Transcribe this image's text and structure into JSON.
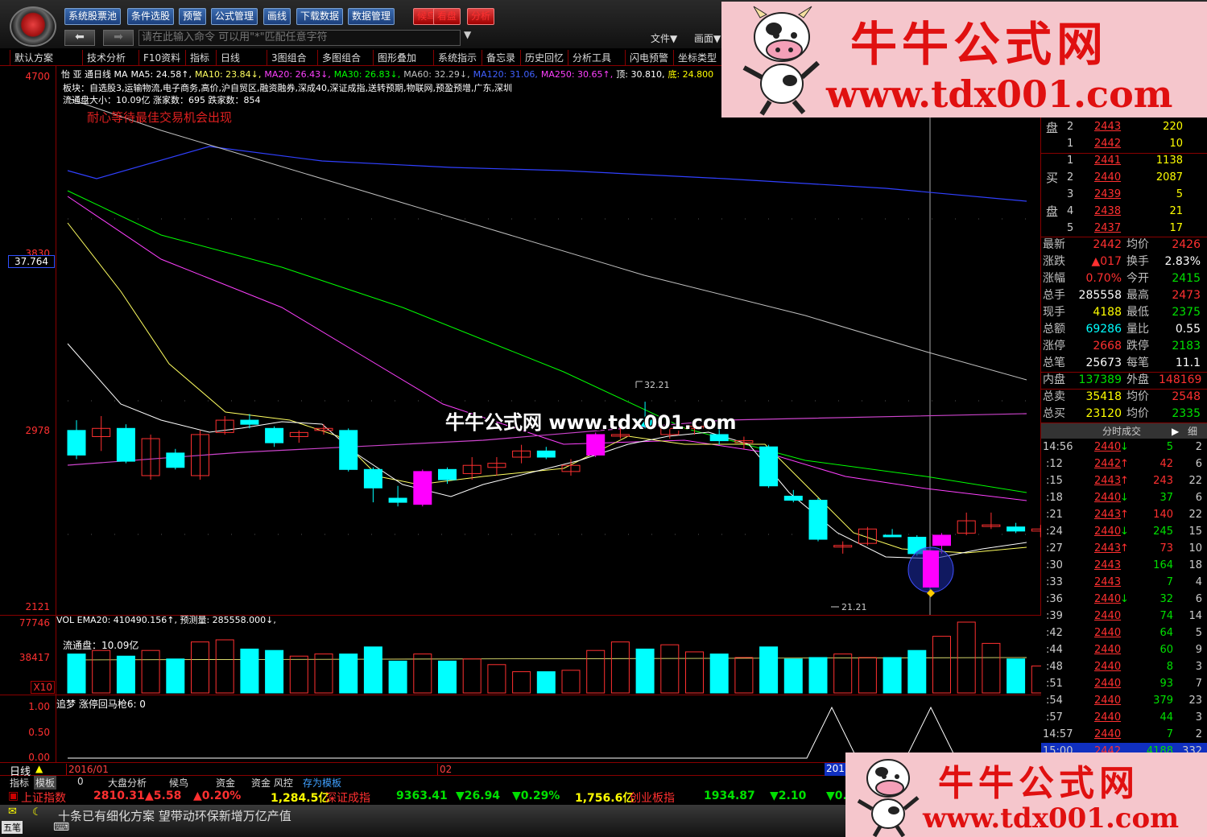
{
  "toolbar": {
    "buttons": [
      "系统股票池",
      "条件选股",
      "预警",
      "公式管理",
      "画线",
      "下载数据",
      "数据管理",
      "候鸟",
      "看盘",
      "分析"
    ],
    "command_placeholder": "请在此输入命令   可以用\"*\"匹配任意字符",
    "file_menu": "文件▼",
    "view_menu": "画面▼"
  },
  "toolbar2": [
    "默认方案",
    "技术分析",
    "F10资料",
    "指标",
    "日线",
    "3图组合",
    "多图组合",
    "图形叠加",
    "系统指示",
    "备忘录",
    "历史回忆",
    "分析工具",
    "闪电预警",
    "坐标类型"
  ],
  "chart": {
    "stock_line": "怡 亚 通日线 MA MA5: 24.58↑, MA10: 23.84↓, MA20: 26.43↓, MA30: 26.83↓, MA60: 32.29↓, MA120: 31.06, MA250: 30.65↑, 顶: 30.810, 底: 24.800",
    "ma_labels": [
      {
        "text": "怡 亚 通日线 MA",
        "color": "#ffffff"
      },
      {
        "text": "MA5: 24.58↑,",
        "color": "#ffffff"
      },
      {
        "text": "MA10: 23.84↓,",
        "color": "#ffff60"
      },
      {
        "text": "MA20: 26.43↓,",
        "color": "#ff40ff"
      },
      {
        "text": "MA30: 26.83↓,",
        "color": "#00ff00"
      },
      {
        "text": "MA60: 32.29↓,",
        "color": "#c0c0c0"
      },
      {
        "text": "MA120: 31.06,",
        "color": "#4060ff"
      },
      {
        "text": "MA250: 30.65↑,",
        "color": "#ff40ff"
      },
      {
        "text": "顶: 30.810,",
        "color": "#ffffff"
      },
      {
        "text": "底: 24.800",
        "color": "#ffff00"
      }
    ],
    "sector": "板块：自选股3,运输物流,电子商务,高价,沪自贸区,融资融券,深成40,深证成指,送转预期,物联网,预盈预增,广东,深圳",
    "circulation": "流通盘大小：10.09亿   涨家数：695    跌家数：854",
    "advice": "耐心等待最佳交易机会出现",
    "y_labels": [
      "4700",
      "3830",
      "2978",
      "2121"
    ],
    "price_box": "37.764",
    "high_label": "32.21",
    "low_label": "21.21",
    "watermark_center": "牛牛公式网 www.tdx001.com"
  },
  "volume": {
    "header": "VOL EMA20: 410490.156↑, 预测量: 285558.000↓,",
    "float": "流通盘：10.09亿",
    "y_labels": [
      "77746",
      "38417",
      "X10"
    ]
  },
  "indicator": {
    "header": "追梦 涨停回马枪6: 0",
    "y_labels": [
      "1.00",
      "0.50",
      "0.00"
    ]
  },
  "timeline": {
    "period": "日线",
    "d1": "2016/01",
    "d2": "02",
    "d3": "201"
  },
  "tabs": [
    "指标",
    "模板",
    "0",
    "大盘分析",
    "候鸟",
    "资金",
    "资金 风控",
    "存为模板"
  ],
  "index_bar": [
    {
      "name": "上证指数",
      "value": "2810.31",
      "chg": "▲5.58",
      "pct": "▲0.20%",
      "amt": "1,284.5亿"
    },
    {
      "name": "深证成指",
      "value": "9363.41",
      "chg": "▼26.94",
      "pct": "▼0.29%",
      "amt": "1,756.6亿"
    },
    {
      "name": "创业板指",
      "value": "1934.87",
      "chg": "▼2.10",
      "pct": "▼0.",
      "amt": ""
    }
  ],
  "news": "十条已有细化方案 望带动环保新增万亿产值",
  "input_mode": "五笔",
  "orderbook": {
    "sell": [
      {
        "lvl": "2",
        "price": "2443",
        "vol": "220"
      },
      {
        "lvl": "1",
        "price": "2442",
        "vol": "10"
      }
    ],
    "buy": [
      {
        "lvl": "1",
        "price": "2441",
        "vol": "1138"
      },
      {
        "lvl": "2",
        "price": "2440",
        "vol": "2087"
      },
      {
        "lvl": "3",
        "price": "2439",
        "vol": "5"
      },
      {
        "lvl": "4",
        "price": "2438",
        "vol": "21"
      },
      {
        "lvl": "5",
        "price": "2437",
        "vol": "17"
      }
    ],
    "sell_label": "盘",
    "buy_label_1": "买",
    "buy_label_2": "盘"
  },
  "stats": [
    {
      "l1": "最新",
      "v1": "2442",
      "c1": "#ff3030",
      "l2": "均价",
      "v2": "2426",
      "c2": "#ff3030"
    },
    {
      "l1": "涨跌",
      "v1": "▲017",
      "c1": "#ff3030",
      "l2": "换手",
      "v2": "2.83%",
      "c2": "#ffffff"
    },
    {
      "l1": "涨幅",
      "v1": "0.70%",
      "c1": "#ff3030",
      "l2": "今开",
      "v2": "2415",
      "c2": "#00e000"
    },
    {
      "l1": "总手",
      "v1": "285558",
      "c1": "#ffffff",
      "l2": "最高",
      "v2": "2473",
      "c2": "#ff3030"
    },
    {
      "l1": "现手",
      "v1": "4188",
      "c1": "#ffff00",
      "l2": "最低",
      "v2": "2375",
      "c2": "#00e000"
    },
    {
      "l1": "总额",
      "v1": "69286",
      "c1": "#00ffff",
      "l2": "量比",
      "v2": "0.55",
      "c2": "#ffffff"
    },
    {
      "l1": "涨停",
      "v1": "2668",
      "c1": "#ff3030",
      "l2": "跌停",
      "v2": "2183",
      "c2": "#00e000"
    },
    {
      "l1": "总笔",
      "v1": "25673",
      "c1": "#ffffff",
      "l2": "每笔",
      "v2": "11.1",
      "c2": "#ffffff"
    },
    {
      "l1": "内盘",
      "v1": "137389",
      "c1": "#00e000",
      "l2": "外盘",
      "v2": "148169",
      "c2": "#ff3030"
    },
    {
      "l1": "总卖",
      "v1": "35418",
      "c1": "#ffff00",
      "l2": "均价",
      "v2": "2548",
      "c2": "#ff3030"
    },
    {
      "l1": "总买",
      "v1": "23120",
      "c1": "#ffff00",
      "l2": "均价",
      "v2": "2335",
      "c2": "#00e000"
    }
  ],
  "trades_header": "分时成交",
  "trades_tab": "细",
  "trades": [
    {
      "t": "14:56",
      "p": "2440↓",
      "v": "5",
      "n": "2"
    },
    {
      "t": ":12",
      "p": "2442↑",
      "v": "42",
      "n": "6"
    },
    {
      "t": ":15",
      "p": "2443↑",
      "v": "243",
      "n": "22"
    },
    {
      "t": ":18",
      "p": "2440↓",
      "v": "37",
      "n": "6"
    },
    {
      "t": ":21",
      "p": "2443↑",
      "v": "140",
      "n": "22"
    },
    {
      "t": ":24",
      "p": "2440↓",
      "v": "245",
      "n": "15"
    },
    {
      "t": ":27",
      "p": "2443↑",
      "v": "73",
      "n": "10"
    },
    {
      "t": ":30",
      "p": "2443",
      "v": "164",
      "n": "18"
    },
    {
      "t": ":33",
      "p": "2443",
      "v": "7",
      "n": "4"
    },
    {
      "t": ":36",
      "p": "2440↓",
      "v": "32",
      "n": "6"
    },
    {
      "t": ":39",
      "p": "2440",
      "v": "74",
      "n": "14"
    },
    {
      "t": ":42",
      "p": "2440",
      "v": "64",
      "n": "5"
    },
    {
      "t": ":44",
      "p": "2440",
      "v": "60",
      "n": "9"
    },
    {
      "t": ":48",
      "p": "2440",
      "v": "8",
      "n": "3"
    },
    {
      "t": ":51",
      "p": "2440",
      "v": "93",
      "n": "7"
    },
    {
      "t": ":54",
      "p": "2440",
      "v": "379",
      "n": "23"
    },
    {
      "t": ":57",
      "p": "2440",
      "v": "44",
      "n": "3"
    },
    {
      "t": "14:57",
      "p": "2440",
      "v": "7",
      "n": "2"
    },
    {
      "t": "15:00",
      "p": "2442",
      "v": "4188",
      "n": "332"
    }
  ],
  "watermark": {
    "title": "牛牛公式网",
    "url": "www.tdx001.com"
  },
  "colors": {
    "up": "#ff3030",
    "down": "#00ffff",
    "magenta": "#ff00ff",
    "ma5": "#ffffff",
    "ma10": "#ffff60",
    "ma20": "#ff40ff",
    "ma30": "#00ff00",
    "ma60": "#c0c0c0",
    "ma120": "#3040ff",
    "ma250": "#cc44cc"
  },
  "chart_data": {
    "type": "candlestick",
    "y_ticks": [
      "4700",
      "3830",
      "2978",
      "2121"
    ],
    "candles": [
      {
        "o": 2860,
        "c": 2980,
        "h": 3030,
        "l": 2840,
        "dir": "down"
      },
      {
        "o": 2950,
        "c": 2990,
        "h": 3050,
        "l": 2880,
        "dir": "up"
      },
      {
        "o": 2990,
        "c": 2830,
        "h": 3010,
        "l": 2820,
        "dir": "down"
      },
      {
        "o": 2760,
        "c": 2940,
        "h": 2960,
        "l": 2740,
        "dir": "up"
      },
      {
        "o": 2870,
        "c": 2800,
        "h": 2890,
        "l": 2790,
        "dir": "down"
      },
      {
        "o": 2760,
        "c": 2960,
        "h": 2980,
        "l": 2740,
        "dir": "up"
      },
      {
        "o": 2970,
        "c": 3030,
        "h": 3050,
        "l": 2960,
        "dir": "up"
      },
      {
        "o": 3030,
        "c": 3010,
        "h": 3060,
        "l": 2990,
        "dir": "down"
      },
      {
        "o": 2990,
        "c": 2920,
        "h": 3000,
        "l": 2900,
        "dir": "down"
      },
      {
        "o": 2950,
        "c": 2970,
        "h": 2980,
        "l": 2920,
        "dir": "up"
      },
      {
        "o": 2980,
        "c": 2990,
        "h": 3010,
        "l": 2960,
        "dir": "up"
      },
      {
        "o": 2980,
        "c": 2790,
        "h": 2990,
        "l": 2780,
        "dir": "down"
      },
      {
        "o": 2790,
        "c": 2700,
        "h": 2800,
        "l": 2630,
        "dir": "down"
      },
      {
        "o": 2650,
        "c": 2630,
        "h": 2710,
        "l": 2610,
        "dir": "down"
      },
      {
        "o": 2620,
        "c": 2780,
        "h": 2790,
        "l": 2610,
        "dir": "mag"
      },
      {
        "o": 2790,
        "c": 2740,
        "h": 2800,
        "l": 2720,
        "dir": "down"
      },
      {
        "o": 2770,
        "c": 2810,
        "h": 2850,
        "l": 2740,
        "dir": "up"
      },
      {
        "o": 2800,
        "c": 2820,
        "h": 2850,
        "l": 2760,
        "dir": "up"
      },
      {
        "o": 2850,
        "c": 2880,
        "h": 2910,
        "l": 2820,
        "dir": "up"
      },
      {
        "o": 2880,
        "c": 2850,
        "h": 2900,
        "l": 2840,
        "dir": "down"
      },
      {
        "o": 2780,
        "c": 2810,
        "h": 2840,
        "l": 2760,
        "dir": "up"
      },
      {
        "o": 2860,
        "c": 2960,
        "h": 2970,
        "l": 2850,
        "dir": "mag"
      },
      {
        "o": 2960,
        "c": 2960,
        "h": 2990,
        "l": 2940,
        "dir": "up"
      },
      {
        "o": 3000,
        "c": 3030,
        "h": 3120,
        "l": 2990,
        "dir": "down"
      },
      {
        "o": 2960,
        "c": 2990,
        "h": 3010,
        "l": 2940,
        "dir": "up"
      },
      {
        "o": 2990,
        "c": 3000,
        "h": 3010,
        "l": 2960,
        "dir": "up"
      },
      {
        "o": 2960,
        "c": 2930,
        "h": 2990,
        "l": 2910,
        "dir": "down"
      },
      {
        "o": 2920,
        "c": 2930,
        "h": 2950,
        "l": 2890,
        "dir": "up"
      },
      {
        "o": 2900,
        "c": 2710,
        "h": 2910,
        "l": 2700,
        "dir": "down"
      },
      {
        "o": 2660,
        "c": 2640,
        "h": 2690,
        "l": 2630,
        "dir": "down"
      },
      {
        "o": 2640,
        "c": 2450,
        "h": 2650,
        "l": 2440,
        "dir": "down"
      },
      {
        "o": 2420,
        "c": 2420,
        "h": 2440,
        "l": 2380,
        "dir": "up"
      },
      {
        "o": 2500,
        "c": 2430,
        "h": 2510,
        "l": 2420,
        "dir": "up"
      },
      {
        "o": 2470,
        "c": 2470,
        "h": 2500,
        "l": 2460,
        "dir": "down"
      },
      {
        "o": 2460,
        "c": 2380,
        "h": 2470,
        "l": 2370,
        "dir": "down"
      },
      {
        "o": 2420,
        "c": 2470,
        "h": 2480,
        "l": 2380,
        "dir": "mag"
      },
      {
        "o": 2480,
        "c": 2540,
        "h": 2580,
        "l": 2470,
        "dir": "up"
      },
      {
        "o": 2520,
        "c": 2520,
        "h": 2580,
        "l": 2500,
        "dir": "up"
      },
      {
        "o": 2510,
        "c": 2490,
        "h": 2530,
        "l": 2480,
        "dir": "down"
      },
      {
        "o": 2500,
        "c": 2490,
        "h": 2520,
        "l": 2460,
        "dir": "up"
      }
    ],
    "volumes": [
      {
        "v": 0.55,
        "dir": "down"
      },
      {
        "v": 0.6,
        "dir": "up"
      },
      {
        "v": 0.52,
        "dir": "down"
      },
      {
        "v": 0.6,
        "dir": "up"
      },
      {
        "v": 0.48,
        "dir": "down"
      },
      {
        "v": 0.72,
        "dir": "up"
      },
      {
        "v": 0.75,
        "dir": "up"
      },
      {
        "v": 0.62,
        "dir": "down"
      },
      {
        "v": 0.6,
        "dir": "down"
      },
      {
        "v": 0.52,
        "dir": "up"
      },
      {
        "v": 0.55,
        "dir": "up"
      },
      {
        "v": 0.55,
        "dir": "down"
      },
      {
        "v": 0.65,
        "dir": "down"
      },
      {
        "v": 0.45,
        "dir": "down"
      },
      {
        "v": 0.55,
        "dir": "up"
      },
      {
        "v": 0.45,
        "dir": "down"
      },
      {
        "v": 0.48,
        "dir": "up"
      },
      {
        "v": 0.4,
        "dir": "up"
      },
      {
        "v": 0.3,
        "dir": "up"
      },
      {
        "v": 0.3,
        "dir": "down"
      },
      {
        "v": 0.32,
        "dir": "up"
      },
      {
        "v": 0.6,
        "dir": "up"
      },
      {
        "v": 0.72,
        "dir": "up"
      },
      {
        "v": 0.62,
        "dir": "down"
      },
      {
        "v": 0.68,
        "dir": "up"
      },
      {
        "v": 0.58,
        "dir": "up"
      },
      {
        "v": 0.55,
        "dir": "down"
      },
      {
        "v": 0.5,
        "dir": "up"
      },
      {
        "v": 0.65,
        "dir": "down"
      },
      {
        "v": 0.48,
        "dir": "down"
      },
      {
        "v": 0.5,
        "dir": "down"
      },
      {
        "v": 0.55,
        "dir": "up"
      },
      {
        "v": 0.5,
        "dir": "up"
      },
      {
        "v": 0.5,
        "dir": "down"
      },
      {
        "v": 0.6,
        "dir": "down"
      },
      {
        "v": 0.8,
        "dir": "up"
      },
      {
        "v": 1.0,
        "dir": "up"
      },
      {
        "v": 0.7,
        "dir": "up"
      },
      {
        "v": 0.48,
        "dir": "down"
      },
      {
        "v": 0.38,
        "dir": "up"
      }
    ]
  }
}
